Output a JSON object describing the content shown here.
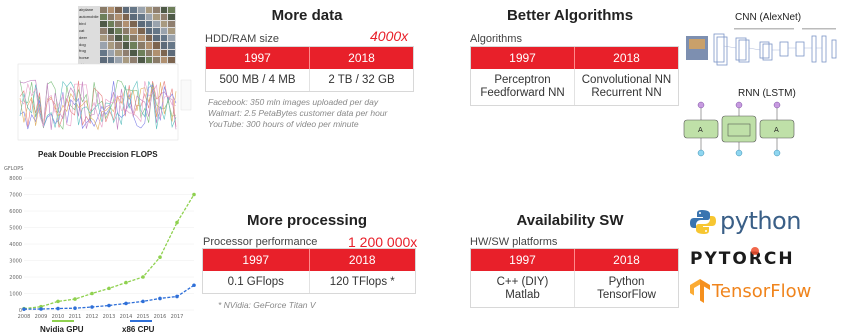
{
  "sections": {
    "more_data": {
      "title": "More data",
      "subtitle": "HDD/RAM size",
      "multiplier": "4000x",
      "headers": [
        "1997",
        "2018"
      ],
      "values": [
        "500 MB / 4 MB",
        "2 TB / 32 GB"
      ],
      "notes": [
        "Facebook: 350 mln images uploaded per day",
        "Walmart: 2.5 PetaBytes customer data per hour",
        "YouTube: 300 hours of video per minute"
      ]
    },
    "better_algorithms": {
      "title": "Better Algorithms",
      "subtitle": "Algorithms",
      "headers": [
        "1997",
        "2018"
      ],
      "values": [
        "Perceptron\nFeedforward NN",
        "Convolutional NN\nRecurrent NN"
      ],
      "cnn_label": "CNN (AlexNet)",
      "rnn_label": "RNN (LSTM)"
    },
    "more_processing": {
      "title": "More processing",
      "subtitle": "Processor performance",
      "multiplier": "1 200 000x",
      "headers": [
        "1997",
        "2018"
      ],
      "values": [
        "0.1 GFlops",
        "120 TFlops *"
      ],
      "note": "* NVidia: GeForce Titan V"
    },
    "availability_sw": {
      "title": "Availability SW",
      "subtitle": "HW/SW platforms",
      "headers": [
        "1997",
        "2018"
      ],
      "values": [
        "C++ (DIY)\nMatlab",
        "Python\nTensorFlow"
      ],
      "logos": {
        "python": "python",
        "pytorch": "PYTORCH",
        "tensorflow": "TensorFlow"
      }
    }
  },
  "left_figures": {
    "dataset_labels": [
      "airplane",
      "automobile",
      "bird",
      "cat",
      "deer",
      "dog",
      "frog",
      "horse",
      "ship",
      "truck"
    ],
    "flops_caption": "Peak Double Preccision FLOPS",
    "gflops_axis": "GFLOPS",
    "legend": {
      "gpu": "Nvidia GPU",
      "cpu": "x86 CPU"
    }
  },
  "chart_data": {
    "type": "line",
    "title": "Peak Double Preccision FLOPS",
    "ylabel": "GFLOPS",
    "x": [
      "2008",
      "2009",
      "2010",
      "2011",
      "2012",
      "2013",
      "2014",
      "2015",
      "2016",
      "2017"
    ],
    "ylim": [
      0,
      8000
    ],
    "yticks": [
      0,
      1000,
      2000,
      3000,
      4000,
      5000,
      6000,
      7000,
      8000
    ],
    "series": [
      {
        "name": "Nvidia GPU",
        "color": "#8fd14f",
        "values": [
          80,
          200,
          520,
          660,
          1000,
          1310,
          1660,
          2000,
          3200,
          5300,
          7000
        ]
      },
      {
        "name": "x86 CPU",
        "color": "#2e6fd8",
        "values": [
          50,
          60,
          90,
          110,
          180,
          270,
          400,
          520,
          700,
          820,
          1500
        ]
      }
    ]
  },
  "colors": {
    "accent": "#e8202a"
  }
}
